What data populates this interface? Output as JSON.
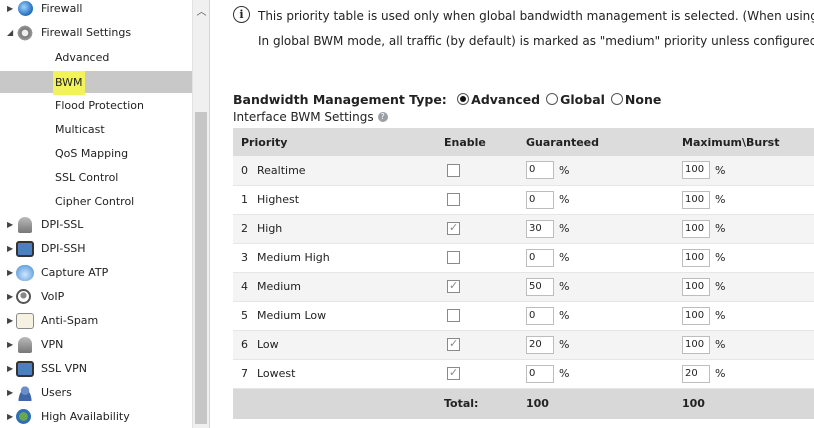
{
  "sidebar": {
    "items": [
      {
        "label": "Firewall",
        "icon": "firewall-globe-icon",
        "expander": "collapsed"
      },
      {
        "label": "Firewall Settings",
        "icon": "firewall-settings-gear-icon",
        "expander": "expanded"
      },
      {
        "label": "Advanced"
      },
      {
        "label": "BWM",
        "selected": true,
        "highlighted": true
      },
      {
        "label": "Flood Protection"
      },
      {
        "label": "Multicast"
      },
      {
        "label": "QoS Mapping"
      },
      {
        "label": "SSL Control"
      },
      {
        "label": "Cipher Control"
      },
      {
        "label": "DPI-SSL",
        "icon": "lock-icon",
        "expander": "collapsed"
      },
      {
        "label": "DPI-SSH",
        "icon": "screen-icon",
        "expander": "collapsed"
      },
      {
        "label": "Capture ATP",
        "icon": "cloud-icon",
        "expander": "collapsed"
      },
      {
        "label": "VoIP",
        "icon": "headset-icon",
        "expander": "collapsed"
      },
      {
        "label": "Anti-Spam",
        "icon": "mail-icon",
        "expander": "collapsed"
      },
      {
        "label": "VPN",
        "icon": "lock-icon",
        "expander": "collapsed"
      },
      {
        "label": "SSL VPN",
        "icon": "screen-icon",
        "expander": "collapsed"
      },
      {
        "label": "Users",
        "icon": "users-icon",
        "expander": "collapsed"
      },
      {
        "label": "High Availability",
        "icon": "high-availability-icon",
        "expander": "collapsed"
      }
    ]
  },
  "info": {
    "icon_glyph": "i",
    "line1": "This priority table is used only when global bandwidth management is selected. (When using lega",
    "line2": "In global BWM mode, all traffic (by default) is marked as \"medium\" priority unless configured via"
  },
  "bwm_type": {
    "label": "Bandwidth Management Type:",
    "options": [
      {
        "label": "Advanced",
        "checked": true
      },
      {
        "label": "Global",
        "checked": false
      },
      {
        "label": "None",
        "checked": false
      }
    ]
  },
  "interface_settings": {
    "title": "Interface BWM Settings",
    "help_glyph": "?"
  },
  "table": {
    "headers": [
      "Priority",
      "Enable",
      "Guaranteed",
      "Maximum\\Burst"
    ],
    "unit": "%",
    "rows": [
      {
        "num": "0",
        "name": "Realtime",
        "enabled": false,
        "guaranteed": "0",
        "maximum": "100"
      },
      {
        "num": "1",
        "name": "Highest",
        "enabled": false,
        "guaranteed": "0",
        "maximum": "100"
      },
      {
        "num": "2",
        "name": "High",
        "enabled": true,
        "guaranteed": "30",
        "maximum": "100"
      },
      {
        "num": "3",
        "name": "Medium High",
        "enabled": false,
        "guaranteed": "0",
        "maximum": "100"
      },
      {
        "num": "4",
        "name": "Medium",
        "enabled": true,
        "guaranteed": "50",
        "maximum": "100"
      },
      {
        "num": "5",
        "name": "Medium Low",
        "enabled": false,
        "guaranteed": "0",
        "maximum": "100"
      },
      {
        "num": "6",
        "name": "Low",
        "enabled": true,
        "guaranteed": "20",
        "maximum": "100"
      },
      {
        "num": "7",
        "name": "Lowest",
        "enabled": true,
        "guaranteed": "0",
        "maximum": "20"
      }
    ],
    "total_label": "Total:",
    "total_guaranteed": "100",
    "total_maximum": "100"
  },
  "colors": {
    "selected_row": "#c8c8c8",
    "highlight": "#f2f25a",
    "table_header": "#dcdcdc",
    "table_footer": "#d8d8d8"
  }
}
